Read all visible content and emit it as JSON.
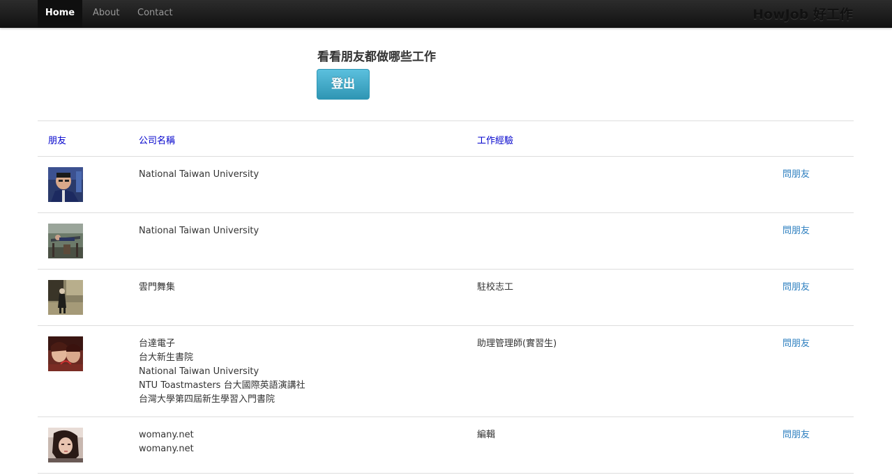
{
  "navbar": {
    "items": [
      "Home",
      "About",
      "Contact"
    ],
    "brand": "HowJob 好工作"
  },
  "hero": {
    "title": "看看朋友都做哪些工作",
    "logout_label": "登出"
  },
  "table": {
    "headers": [
      "朋友",
      "公司名稱",
      "工作經驗"
    ],
    "rows": [
      {
        "companies": [
          "National Taiwan University"
        ],
        "experiences": [],
        "action": "問朋友"
      },
      {
        "companies": [
          "National Taiwan University"
        ],
        "experiences": [],
        "action": "問朋友"
      },
      {
        "companies": [
          "雲門舞集"
        ],
        "experiences": [
          "駐校志工"
        ],
        "action": "問朋友"
      },
      {
        "companies": [
          "台達電子",
          "台大新生書院",
          "National Taiwan University",
          "NTU Toastmasters 台大國際英語演講社",
          "台灣大學第四屆新生學習入門書院"
        ],
        "experiences": [
          "助理管理師(實習生)"
        ],
        "action": "問朋友"
      },
      {
        "companies": [
          "womany.net",
          "womany.net"
        ],
        "experiences": [
          "編輯"
        ],
        "action": "問朋友"
      }
    ]
  }
}
